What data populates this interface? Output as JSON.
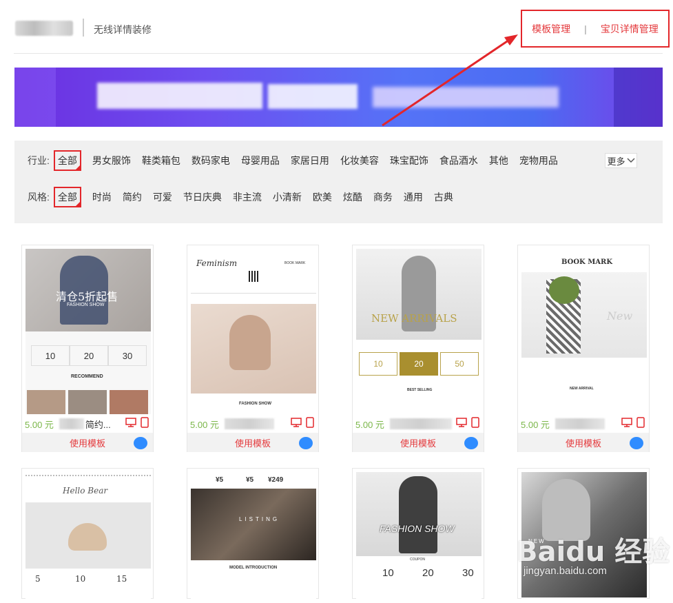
{
  "header": {
    "title": "无线详情装修",
    "link_template": "模板管理",
    "link_sep": "|",
    "link_detail": "宝贝详情管理"
  },
  "filters": {
    "industry_label": "行业:",
    "industry_items": [
      "全部",
      "男女服饰",
      "鞋类箱包",
      "数码家电",
      "母婴用品",
      "家居日用",
      "化妆美容",
      "珠宝配饰",
      "食品酒水",
      "其他",
      "宠物用品"
    ],
    "style_label": "风格:",
    "style_items": [
      "全部",
      "时尚",
      "简约",
      "可爱",
      "节日庆典",
      "非主流",
      "小清新",
      "欧美",
      "炫酷",
      "商务",
      "通用",
      "古典"
    ],
    "more_label": "更多"
  },
  "cards": [
    {
      "price": "5.00 元",
      "name_tail": "简约...",
      "use_label": "使用模板",
      "thumb_text": "清仓5折起售",
      "thumb_sub": "FASHION SHOW",
      "coupons": [
        "10",
        "20",
        "30"
      ],
      "extra": "RECOMMEND"
    },
    {
      "price": "5.00 元",
      "use_label": "使用模板",
      "thumb_text": "Feminism",
      "thumb_sub": "BOOK MARK",
      "extra": "FASHION SHOW"
    },
    {
      "price": "5.00 元",
      "use_label": "使用模板",
      "thumb_text": "NEW ARRIVALS",
      "coupons": [
        "10",
        "20",
        "50"
      ],
      "extra": "BEST SELLING"
    },
    {
      "price": "5.00 元",
      "use_label": "使用模板",
      "thumb_text": "BOOK MARK",
      "thumb_sub": "New",
      "extra": "NEW ARRIVAL"
    },
    {
      "thumb_text": "Hello Bear",
      "coupons": [
        "5",
        "10",
        "15"
      ]
    },
    {
      "thumb_text": "LISTING",
      "prices": [
        "¥5",
        "¥5",
        "¥249"
      ],
      "extra": "MODEL INTRODUCTION"
    },
    {
      "thumb_text": "FASHION SHOW",
      "thumb_sub": "COUPON",
      "coupons": [
        "10",
        "20",
        "30"
      ]
    },
    {
      "thumb_text": "NEW"
    }
  ],
  "watermark": {
    "main": "Baidu 经验",
    "sub": "jingyan.baidu.com"
  },
  "colors": {
    "accent": "#e4393c",
    "price": "#7ab648",
    "filter_bg": "#f0f0f0"
  }
}
